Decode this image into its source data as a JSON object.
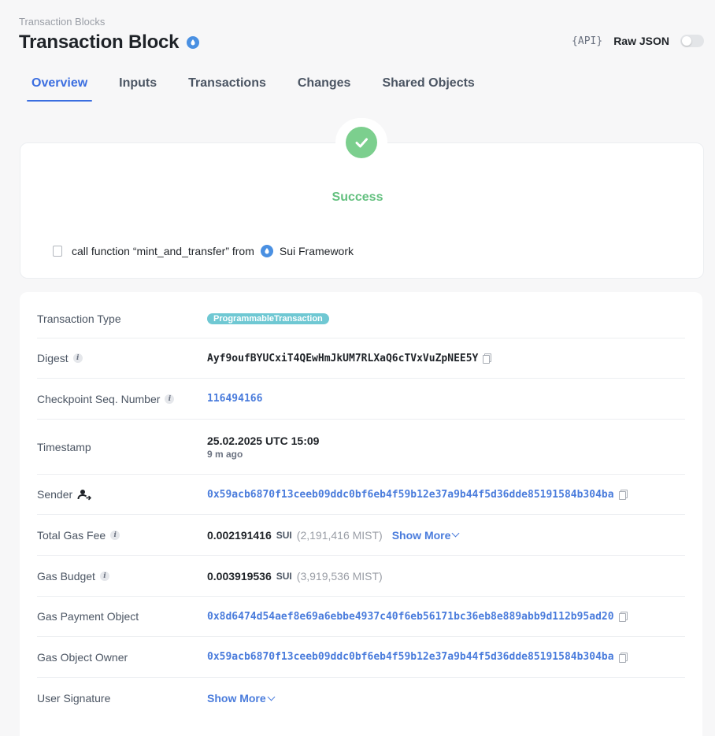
{
  "breadcrumb": "Transaction Blocks",
  "title": "Transaction Block",
  "header": {
    "api_label": "{API}",
    "raw_json_label": "Raw JSON",
    "raw_json_enabled": false
  },
  "tabs": [
    {
      "label": "Overview",
      "active": true
    },
    {
      "label": "Inputs",
      "active": false
    },
    {
      "label": "Transactions",
      "active": false
    },
    {
      "label": "Changes",
      "active": false
    },
    {
      "label": "Shared Objects",
      "active": false
    }
  ],
  "status": {
    "label": "Success",
    "call_text": "call function “mint_and_transfer” from",
    "framework": "Sui Framework"
  },
  "details": {
    "transaction_type": {
      "label": "Transaction Type",
      "value": "ProgrammableTransaction"
    },
    "digest": {
      "label": "Digest",
      "value": "Ayf9oufBYUCxiT4QEwHmJkUM7RLXaQ6cTVxVuZpNEE5Y"
    },
    "checkpoint": {
      "label": "Checkpoint Seq. Number",
      "value": "116494166"
    },
    "timestamp": {
      "label": "Timestamp",
      "value": "25.02.2025 UTC 15:09",
      "relative": "9 m ago"
    },
    "sender": {
      "label": "Sender",
      "value": "0x59acb6870f13ceeb09ddc0bf6eb4f59b12e37a9b44f5d36dde85191584b304ba"
    },
    "total_gas_fee": {
      "label": "Total Gas Fee",
      "value": "0.002191416",
      "unit": "SUI",
      "mist": "(2,191,416 MIST)",
      "show_more": "Show More"
    },
    "gas_budget": {
      "label": "Gas Budget",
      "value": "0.003919536",
      "unit": "SUI",
      "mist": "(3,919,536 MIST)"
    },
    "gas_payment_object": {
      "label": "Gas Payment Object",
      "value": "0x8d6474d54aef8e69a6ebbe4937c40f6eb56171bc36eb8e889abb9d112b95ad20"
    },
    "gas_object_owner": {
      "label": "Gas Object Owner",
      "value": "0x59acb6870f13ceeb09ddc0bf6eb4f59b12e37a9b44f5d36dde85191584b304ba"
    },
    "user_signature": {
      "label": "User Signature",
      "show_more": "Show More"
    }
  },
  "colors": {
    "accent": "#3b6ee0",
    "success": "#63c07f",
    "link": "#4a7cdc",
    "pill": "#6fc8d3"
  }
}
